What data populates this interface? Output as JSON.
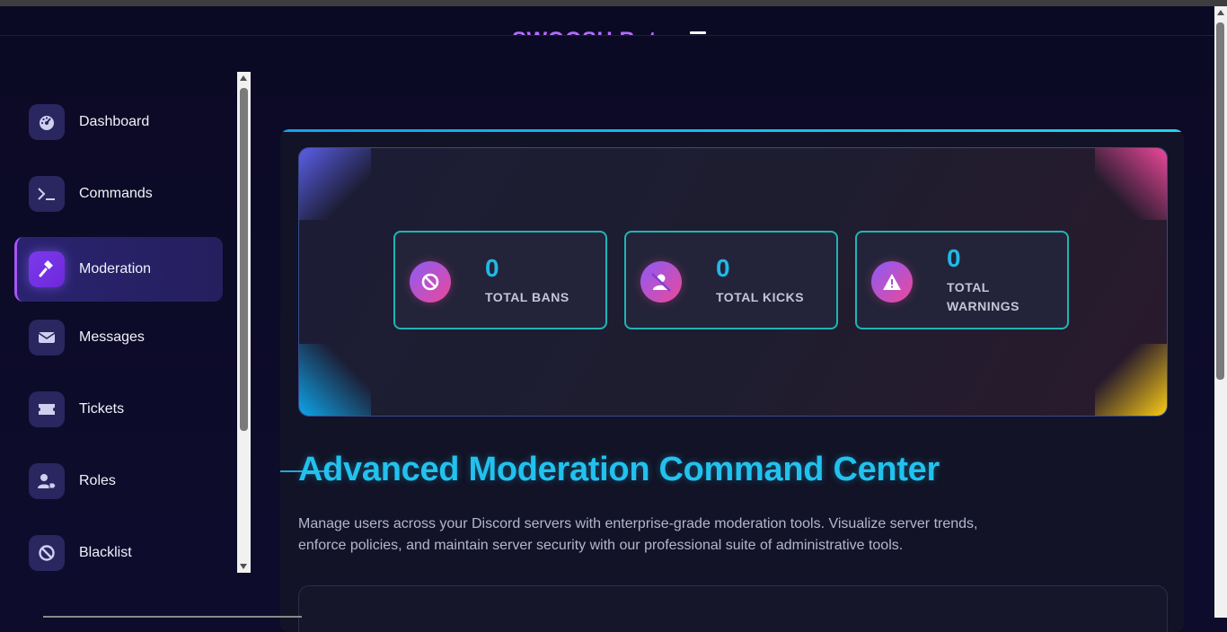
{
  "app": {
    "brand": "SWOOSH Bot"
  },
  "sidebar": {
    "items": [
      {
        "label": "Dashboard",
        "icon": "dashboard-icon",
        "active": false
      },
      {
        "label": "Commands",
        "icon": "terminal-icon",
        "active": false
      },
      {
        "label": "Moderation",
        "icon": "gavel-icon",
        "active": true
      },
      {
        "label": "Messages",
        "icon": "envelope-icon",
        "active": false
      },
      {
        "label": "Tickets",
        "icon": "ticket-icon",
        "active": false
      },
      {
        "label": "Roles",
        "icon": "user-tag-icon",
        "active": false
      },
      {
        "label": "Blacklist",
        "icon": "ban-icon",
        "active": false
      }
    ]
  },
  "stats": [
    {
      "value": "0",
      "label": "TOTAL BANS",
      "icon": "ban-icon"
    },
    {
      "value": "0",
      "label": "TOTAL KICKS",
      "icon": "user-slash-icon"
    },
    {
      "value": "0",
      "label": "TOTAL WARNINGS",
      "icon": "warning-icon"
    }
  ],
  "main": {
    "headline": "Advanced Moderation Command Center",
    "description": "Manage users across your Discord servers with enterprise-grade moderation tools. Visualize server trends, enforce policies, and maintain server security with our professional suite of administrative tools."
  },
  "colors": {
    "accent": "#22c1ee",
    "brand": "#b56bff",
    "active_nav": "#7c3aed",
    "stat_border": "#1fb5b5"
  }
}
